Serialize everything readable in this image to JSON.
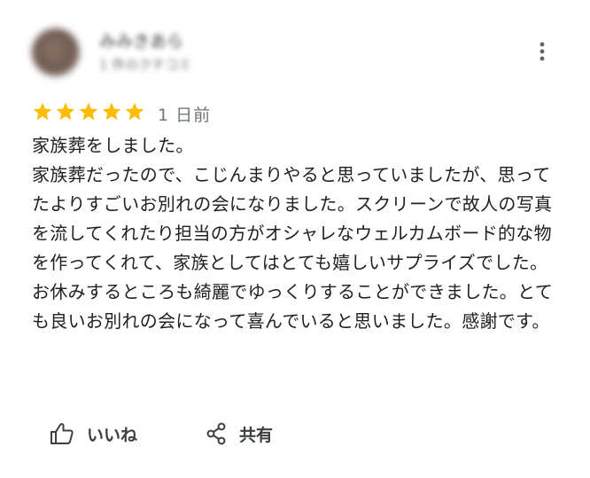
{
  "review": {
    "author": {
      "name": "みみきあら",
      "meta": "1 件のクチコミ"
    },
    "rating": 5,
    "max_rating": 5,
    "date": "1 日前",
    "text_lines": [
      "家族葬をしました。",
      "家族葬だったので、こじんまりやると思っていましたが、思ってたよりすごいお別れの会になりました。スクリーンで故人の写真を流してくれたり担当の方がオシャレなウェルカムボード的な物を作ってくれて、家族としてはとても嬉しいサプライズでした。お休みするところも綺麗でゆっくりすることができました。とても良いお別れの会になって喜んでいると思いました。感謝です。"
    ],
    "star_color": "#fbbc04",
    "actions": {
      "like_label": "いいね",
      "share_label": "共有"
    }
  }
}
